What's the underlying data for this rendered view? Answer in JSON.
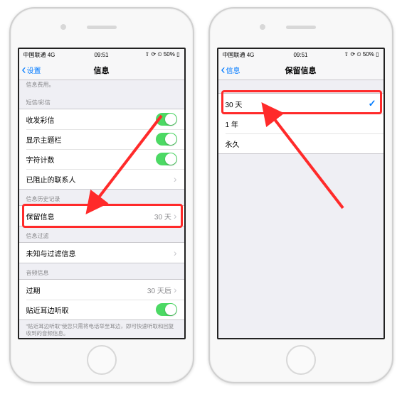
{
  "status": {
    "carrier": "中国联通 4G",
    "time": "09:51",
    "battery": "50%",
    "signal": "••ıll",
    "extra": "⇧ ⟳ ⏲"
  },
  "screen1": {
    "backLabel": "设置",
    "title": "信息",
    "note": "信息费用。",
    "sec_mms": "短信/彩信",
    "items_mms": [
      {
        "label": "收发彩信",
        "on": true
      },
      {
        "label": "显示主题栏",
        "on": true
      },
      {
        "label": "字符计数",
        "on": true
      },
      {
        "label": "已阻止的联系人",
        "disclosure": true
      }
    ],
    "sec_history": "信息历史记录",
    "history_label": "保留信息",
    "history_value": "30 天",
    "sec_filter": "信息过滤",
    "filter_label": "未知与过滤信息",
    "sec_audio": "音频信息",
    "audio_expire_label": "过期",
    "audio_expire_value": "30 天后",
    "audio_raise_label": "贴近耳边听取",
    "audio_raise_on": true,
    "audio_foot": "\"贴近耳边听取\"使您只需将电话举至耳边，即可快速听取和回复收到的音频信息。"
  },
  "screen2": {
    "backLabel": "信息",
    "title": "保留信息",
    "opts": [
      {
        "label": "30 天",
        "selected": true
      },
      {
        "label": "1 年",
        "selected": false
      },
      {
        "label": "永久",
        "selected": false
      }
    ]
  }
}
